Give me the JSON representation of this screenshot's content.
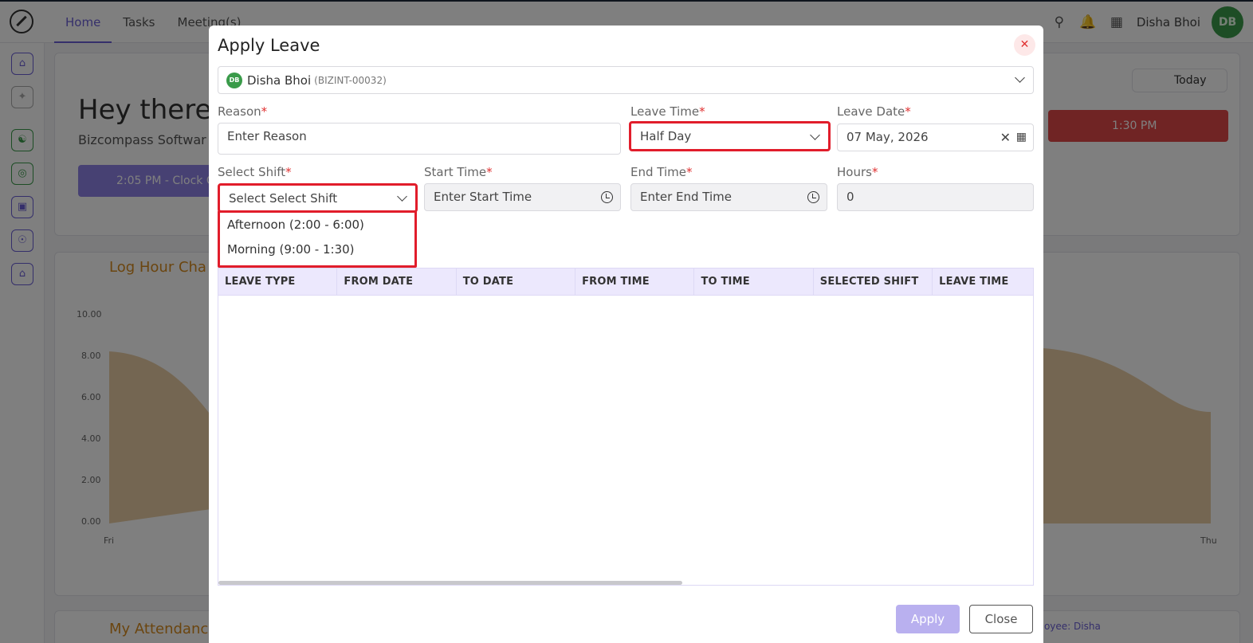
{
  "nav": {
    "tabs": [
      "Home",
      "Tasks",
      "Meeting(s)"
    ],
    "user": "Disha Bhoi",
    "avatar": "DB"
  },
  "dashboard": {
    "greeting": "Hey there!",
    "company": "Bizcompass Softwar",
    "clock_button": "2:05 PM - Clock O",
    "red_button": "1:30 PM",
    "today_button": "Today",
    "log_hour_title": "Log Hour Cha",
    "attendance_title": "My Attendanc",
    "employee_chip": "ployee: Disha",
    "yaxis_ticks": [
      "10.00",
      "8.00",
      "6.00",
      "4.00",
      "2.00",
      "0.00"
    ],
    "xaxis_ticks": [
      "Fri",
      "Thu"
    ]
  },
  "modal": {
    "title": "Apply Leave",
    "employee": {
      "avatar": "DB",
      "name": "Disha Bhoi",
      "code": "(BIZINT-00032)"
    },
    "reason": {
      "label": "Reason",
      "placeholder": "Enter Reason"
    },
    "leave_time": {
      "label": "Leave Time",
      "value": "Half Day"
    },
    "leave_date": {
      "label": "Leave Date",
      "value": "07 May, 2026"
    },
    "select_shift": {
      "label": "Select Shift",
      "value": "Select Select Shift",
      "options": [
        "Afternoon (2:00 - 6:00)",
        "Morning (9:00 - 1:30)"
      ]
    },
    "start_time": {
      "label": "Start Time",
      "placeholder": "Enter Start Time"
    },
    "end_time": {
      "label": "End Time",
      "placeholder": "Enter End Time"
    },
    "hours": {
      "label": "Hours",
      "value": "0"
    },
    "required_mark": "*",
    "table_headers": [
      "LEAVE TYPE",
      "FROM DATE",
      "TO DATE",
      "FROM TIME",
      "TO TIME",
      "SELECTED SHIFT",
      "LEAVE TIME"
    ],
    "apply_label": "Apply",
    "close_label": "Close"
  }
}
